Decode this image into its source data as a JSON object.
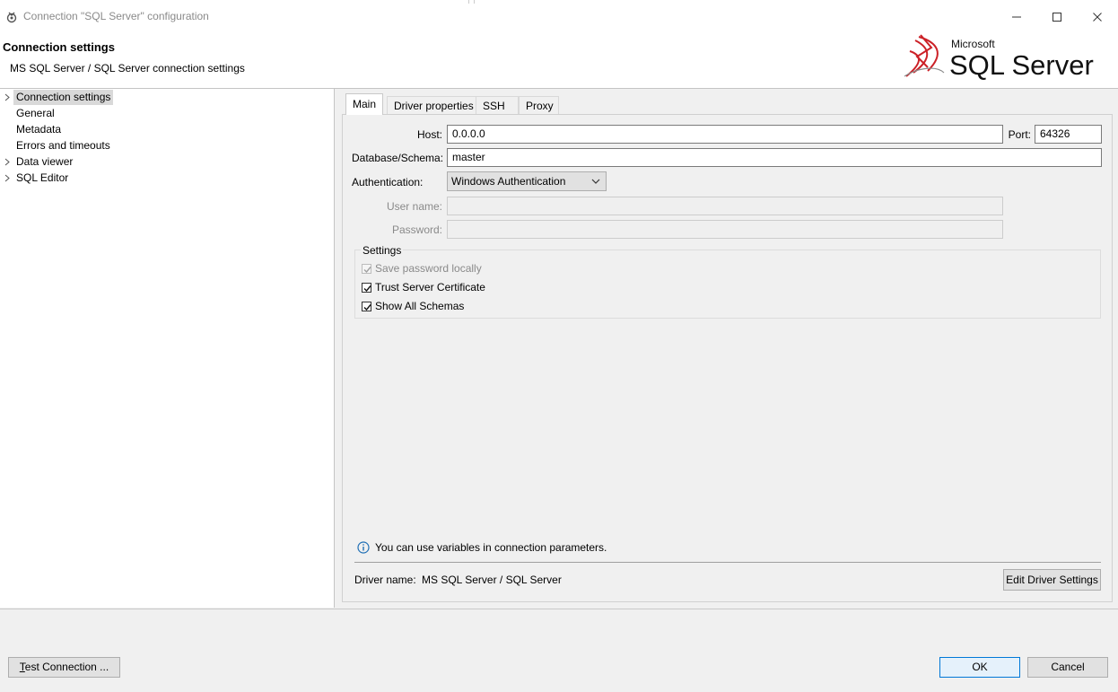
{
  "window": {
    "title": "Connection \"SQL Server\" configuration"
  },
  "header": {
    "title": "Connection settings",
    "subtitle": "MS SQL Server / SQL Server connection settings",
    "logo_brand_top": "Microsoft",
    "logo_brand_main": "SQL Server"
  },
  "nav": {
    "items": [
      {
        "label": "Connection settings",
        "has_arrow": true,
        "selected": true
      },
      {
        "label": "General",
        "has_arrow": false
      },
      {
        "label": "Metadata",
        "has_arrow": false
      },
      {
        "label": "Errors and timeouts",
        "has_arrow": false
      },
      {
        "label": "Data viewer",
        "has_arrow": true
      },
      {
        "label": "SQL Editor",
        "has_arrow": true
      }
    ]
  },
  "tabs": [
    {
      "label": "Main",
      "active": true
    },
    {
      "label": "Driver properties"
    },
    {
      "label": "SSH"
    },
    {
      "label": "Proxy"
    }
  ],
  "form": {
    "host_label": "Host:",
    "host_value": "0.0.0.0",
    "port_label": "Port:",
    "port_value": "64326",
    "database_label": "Database/Schema:",
    "database_value": "master",
    "auth_label": "Authentication:",
    "auth_value": "Windows Authentication",
    "username_label": "User name:",
    "username_value": "",
    "password_label": "Password:",
    "password_value": ""
  },
  "settings": {
    "title": "Settings",
    "save_password": {
      "label": "Save password locally",
      "checked": true,
      "disabled": true
    },
    "trust_cert": {
      "label": "Trust Server Certificate",
      "checked": true
    },
    "show_schemas": {
      "label": "Show All Schemas",
      "checked": true
    }
  },
  "info": {
    "text": "You can use variables in connection parameters."
  },
  "driver": {
    "label": "Driver name:",
    "value": "MS SQL Server / SQL Server",
    "edit_button": "Edit Driver Settings"
  },
  "footer": {
    "test_connection_prefix": "T",
    "test_connection_rest": "est Connection ...",
    "ok": "OK",
    "cancel": "Cancel"
  },
  "colors": {
    "accent": "#0078d7",
    "logo_red": "#cc2127"
  }
}
